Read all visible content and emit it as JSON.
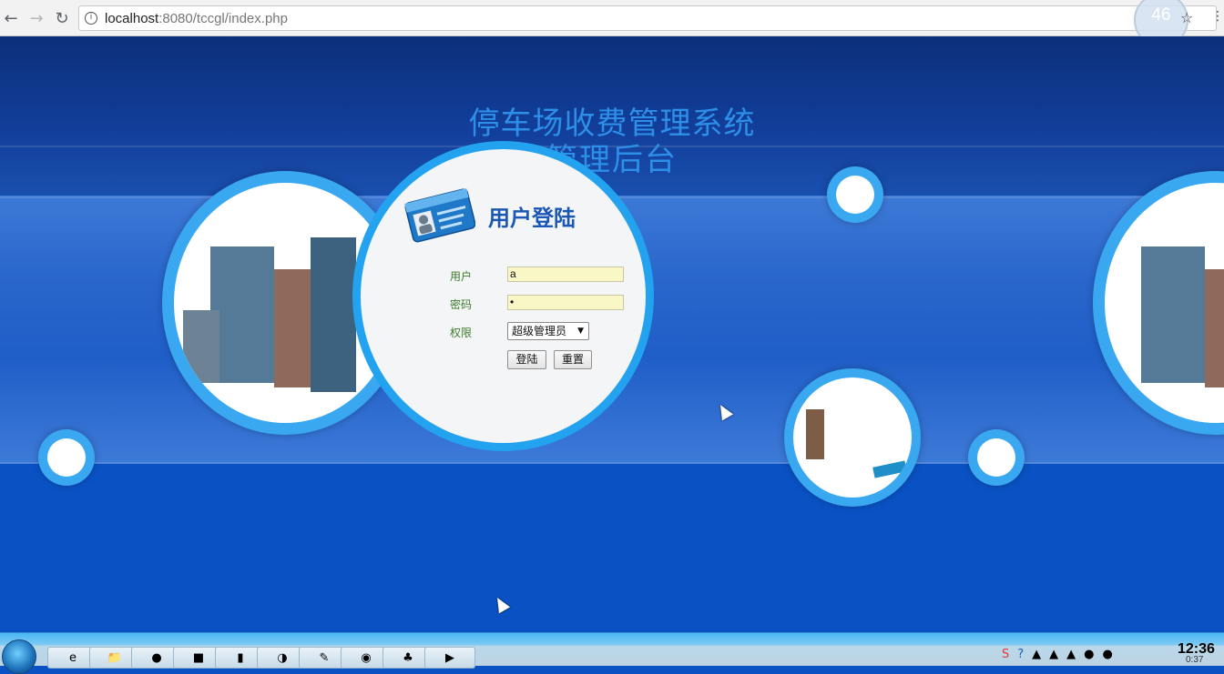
{
  "browser": {
    "back_icon": "back-arrow-icon",
    "forward_icon": "forward-arrow-icon",
    "reload_icon": "reload-icon",
    "url_host": "localhost",
    "url_rest": ":8080/tccgl/index.php",
    "badge_value": "46",
    "star_icon": "bookmark-star-icon"
  },
  "page": {
    "title_line1": "停车场收费管理系统",
    "title_line2": "管理后台"
  },
  "login": {
    "heading": "用户登陆",
    "user_label": "用户",
    "user_value": "a",
    "password_label": "密码",
    "password_value": "•",
    "role_label": "权限",
    "role_selected": "超级管理员",
    "login_button": "登陆",
    "reset_button": "重置"
  },
  "taskbar": {
    "items": [
      "ie",
      "explorer",
      "firefox",
      "app",
      "book",
      "paint",
      "notepad",
      "chrome",
      "cactus",
      "vs"
    ],
    "clock_time": "12:36",
    "clock_sub": "0:37"
  },
  "colors": {
    "page_blue": "#0b54c6",
    "title_blue": "#2d8fe8",
    "ring_blue": "#23a2ef",
    "label_green": "#3d7a2a",
    "input_yellow": "#faf7c6"
  }
}
